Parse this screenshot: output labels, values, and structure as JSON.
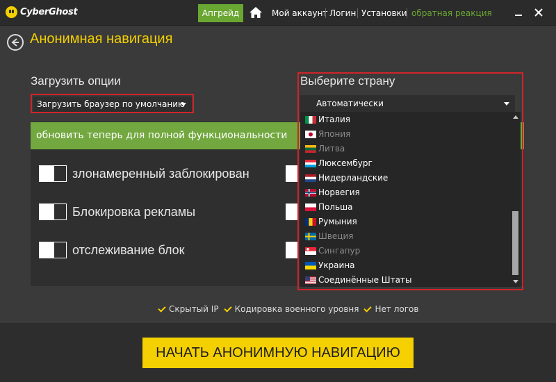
{
  "titlebar": {
    "brand": "CyberGhost",
    "upgrade_label": "Апгрейд",
    "nav": [
      "Мой аккаунт",
      "Логин",
      "Установки",
      "обратная реакция"
    ]
  },
  "header": {
    "title": "Анонимная навигация"
  },
  "options": {
    "label": "Загрузить опции",
    "browser_select_value": "Загрузить браузер по умолчанию"
  },
  "country": {
    "label": "Выберите страну",
    "selected": "Автоматически",
    "items": [
      {
        "name": "Италия",
        "enabled": true,
        "flag": "it"
      },
      {
        "name": "Япония",
        "enabled": false,
        "flag": "jp"
      },
      {
        "name": "Литва",
        "enabled": false,
        "flag": "lt"
      },
      {
        "name": "Люксембург",
        "enabled": true,
        "flag": "lu"
      },
      {
        "name": "Нидерландские",
        "enabled": true,
        "flag": "nl"
      },
      {
        "name": "Норвегия",
        "enabled": true,
        "flag": "no"
      },
      {
        "name": "Польша",
        "enabled": true,
        "flag": "pl"
      },
      {
        "name": "Румыния",
        "enabled": true,
        "flag": "ro"
      },
      {
        "name": "Швеция",
        "enabled": false,
        "flag": "se"
      },
      {
        "name": "Сингапур",
        "enabled": false,
        "flag": "sg"
      },
      {
        "name": "Украина",
        "enabled": true,
        "flag": "ua"
      },
      {
        "name": "Соединённые Штаты",
        "enabled": true,
        "flag": "us"
      }
    ]
  },
  "panel": {
    "banner": "обновить теперь для полной функциональности",
    "toggles": [
      {
        "label": "злонамеренный заблокирован"
      },
      {
        "label": "Блокировка рекламы"
      },
      {
        "label": "отслеживание блок"
      }
    ]
  },
  "features": [
    "Скрытый IP",
    "Кодировка военного уровня",
    "Нет логов"
  ],
  "start_label": "НАЧАТЬ АНОНИМНУЮ НАВИГАЦИЮ",
  "colors": {
    "accent_yellow": "#f4d000",
    "accent_green": "#72a83f",
    "highlight_red": "#d2232a"
  }
}
